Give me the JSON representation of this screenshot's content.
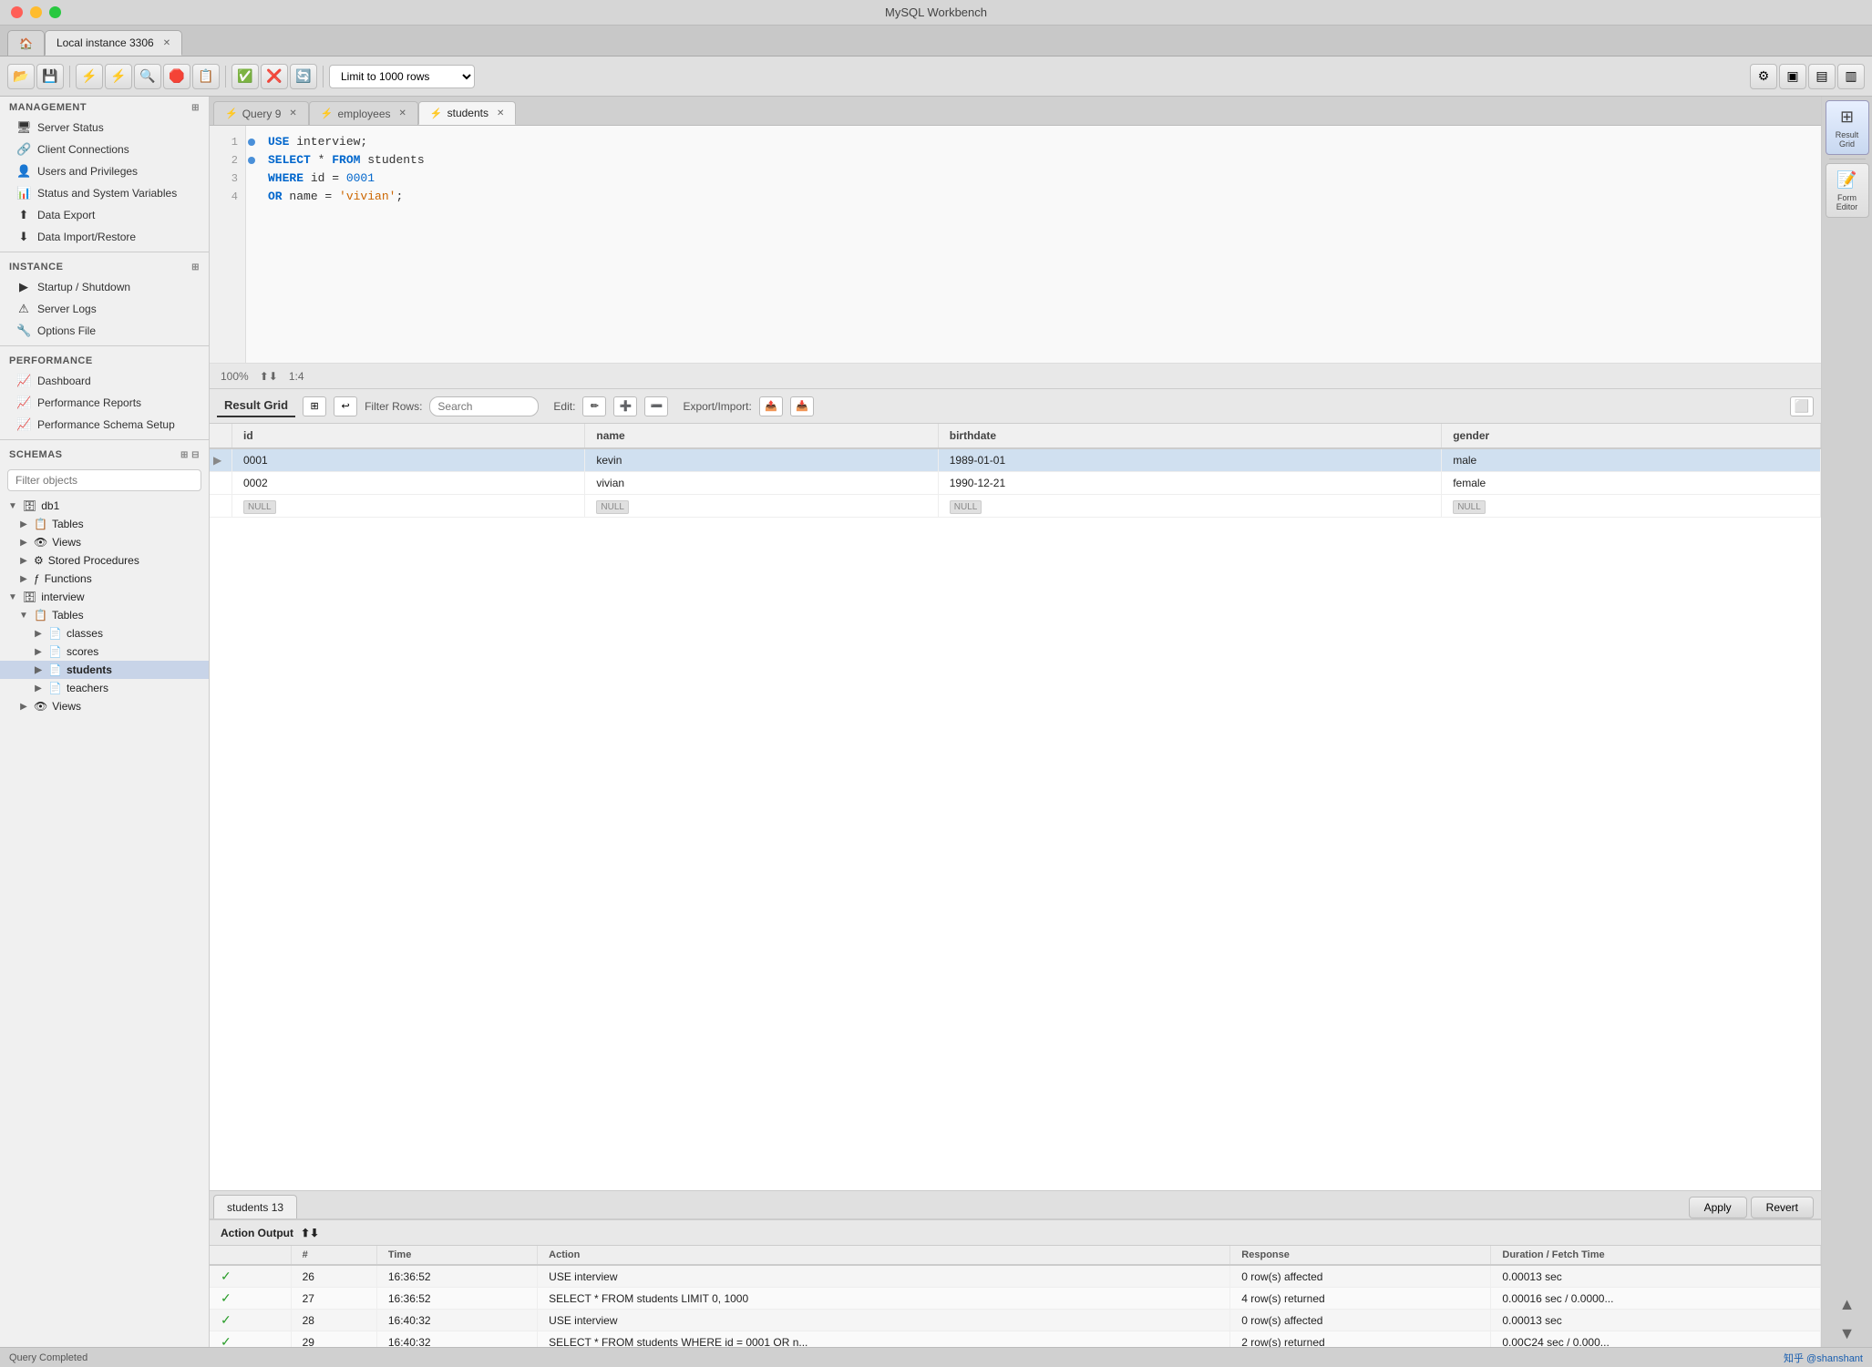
{
  "window": {
    "title": "MySQL Workbench",
    "instance_tab": "Local instance 3306"
  },
  "toolbar": {
    "limit_rows_label": "Limit to 1000 rows"
  },
  "sidebar": {
    "management_section": "MANAGEMENT",
    "management_items": [
      {
        "label": "Server Status",
        "icon": "🖥"
      },
      {
        "label": "Client Connections",
        "icon": "🔗"
      },
      {
        "label": "Users and Privileges",
        "icon": "👤"
      },
      {
        "label": "Status and System Variables",
        "icon": "📊"
      },
      {
        "label": "Data Export",
        "icon": "⬆"
      },
      {
        "label": "Data Import/Restore",
        "icon": "⬇"
      }
    ],
    "instance_section": "INSTANCE",
    "instance_items": [
      {
        "label": "Startup / Shutdown",
        "icon": "▶"
      },
      {
        "label": "Server Logs",
        "icon": "⚠"
      },
      {
        "label": "Options File",
        "icon": "🔧"
      }
    ],
    "performance_section": "PERFORMANCE",
    "performance_items": [
      {
        "label": "Dashboard",
        "icon": "📈"
      },
      {
        "label": "Performance Reports",
        "icon": "📈"
      },
      {
        "label": "Performance Schema Setup",
        "icon": "📈"
      }
    ],
    "schemas_section": "SCHEMAS",
    "filter_placeholder": "Filter objects",
    "db1": {
      "label": "db1",
      "children": [
        {
          "label": "Tables",
          "icon": "🗂"
        },
        {
          "label": "Views",
          "icon": "👁"
        },
        {
          "label": "Stored Procedures",
          "icon": "⚙"
        },
        {
          "label": "Functions",
          "icon": "ƒ"
        }
      ]
    },
    "interview": {
      "label": "interview",
      "children": [
        {
          "label": "Tables",
          "children": [
            {
              "label": "classes",
              "icon": "🗒"
            },
            {
              "label": "scores",
              "icon": "🗒"
            },
            {
              "label": "students",
              "icon": "🗒",
              "active": true
            },
            {
              "label": "teachers",
              "icon": "🗒"
            }
          ]
        },
        {
          "label": "Views",
          "icon": "👁"
        }
      ]
    }
  },
  "query_tabs": [
    {
      "label": "Query 9",
      "icon": "⚡",
      "active": false
    },
    {
      "label": "employees",
      "icon": "⚡",
      "active": false
    },
    {
      "label": "students",
      "icon": "⚡",
      "active": true
    }
  ],
  "editor": {
    "lines": [
      {
        "num": 1,
        "dot": "blue",
        "code": "USE interview;"
      },
      {
        "num": 2,
        "dot": "blue",
        "code": "SELECT * FROM students"
      },
      {
        "num": 3,
        "dot": "empty",
        "code": "WHERE id = 0001"
      },
      {
        "num": 4,
        "dot": "empty",
        "code": "OR name = 'vivian';"
      }
    ],
    "position": "1:4",
    "zoom": "100%"
  },
  "result_grid": {
    "tab_label": "Result Grid",
    "filter_placeholder": "Search",
    "columns": [
      "id",
      "name",
      "birthdate",
      "gender"
    ],
    "rows": [
      {
        "indicator": "▶",
        "id": "0001",
        "name": "kevin",
        "birthdate": "1989-01-01",
        "gender": "male",
        "selected": true
      },
      {
        "indicator": "",
        "id": "0002",
        "name": "vivian",
        "birthdate": "1990-12-21",
        "gender": "female",
        "selected": false
      },
      {
        "indicator": "",
        "id": "NULL",
        "name": "NULL",
        "birthdate": "NULL",
        "gender": "NULL",
        "selected": false,
        "null_row": true
      }
    ],
    "grid_tab_label": "students 13",
    "apply_btn": "Apply",
    "revert_btn": "Revert"
  },
  "action_output": {
    "header": "Action Output",
    "columns": [
      "",
      "Time",
      "Action",
      "Response",
      "Duration / Fetch Time"
    ],
    "rows": [
      {
        "status": "✓",
        "num": "26",
        "time": "16:36:52",
        "action": "USE interview",
        "response": "0 row(s) affected",
        "duration": "0.00013 sec"
      },
      {
        "status": "✓",
        "num": "27",
        "time": "16:36:52",
        "action": "SELECT * FROM students LIMIT 0, 1000",
        "response": "4 row(s) returned",
        "duration": "0.00016 sec / 0.0000..."
      },
      {
        "status": "✓",
        "num": "28",
        "time": "16:40:32",
        "action": "USE interview",
        "response": "0 row(s) affected",
        "duration": "0.00013 sec"
      },
      {
        "status": "✓",
        "num": "29",
        "time": "16:40:32",
        "action": "SELECT * FROM students WHERE id = 0001  OR n...",
        "response": "2 row(s) returned",
        "duration": "0.00C24 sec / 0.000..."
      }
    ]
  },
  "right_panel": {
    "result_grid_btn": "Result\nGrid",
    "form_editor_btn": "Form\nEditor"
  },
  "status_bar": {
    "left": "Query Completed",
    "right": "知乎 @shanshant"
  }
}
